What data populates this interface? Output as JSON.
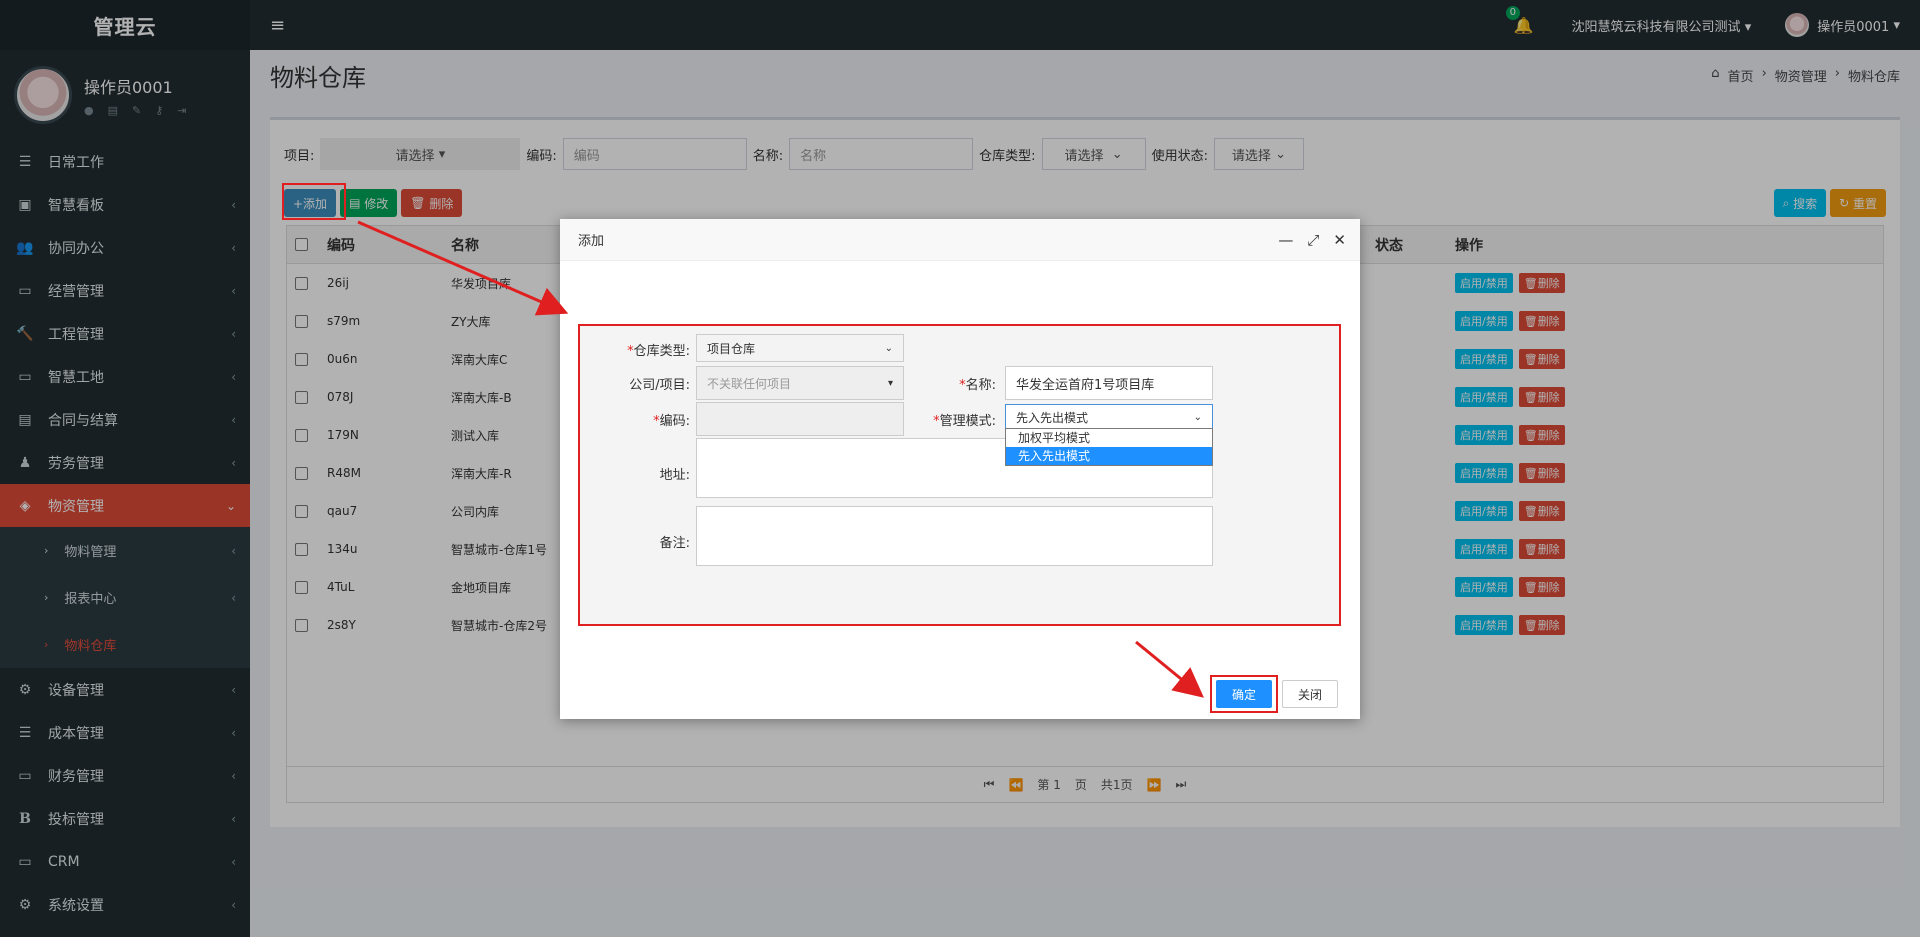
{
  "app": {
    "brand": "管理云",
    "user_name": "操作员0001"
  },
  "header": {
    "notif_count": "0",
    "company": "沈阳慧筑云科技有限公司测试",
    "user": "操作员0001"
  },
  "sidebar": {
    "items": [
      {
        "label": "日常工作",
        "icon": "☰"
      },
      {
        "label": "智慧看板",
        "icon": "▣"
      },
      {
        "label": "协同办公",
        "icon": "👥"
      },
      {
        "label": "经营管理",
        "icon": "▭"
      },
      {
        "label": "工程管理",
        "icon": "🔨"
      },
      {
        "label": "智慧工地",
        "icon": "▭"
      },
      {
        "label": "合同与结算",
        "icon": "▤"
      },
      {
        "label": "劳务管理",
        "icon": "♟"
      },
      {
        "label": "物资管理",
        "icon": "◈"
      }
    ],
    "sub_items": [
      {
        "label": "物料管理"
      },
      {
        "label": "报表中心"
      },
      {
        "label": "物料仓库"
      }
    ],
    "items_after": [
      {
        "label": "设备管理",
        "icon": "⚙"
      },
      {
        "label": "成本管理",
        "icon": "☰"
      },
      {
        "label": "财务管理",
        "icon": "▭"
      },
      {
        "label": "投标管理",
        "icon": "B"
      },
      {
        "label": "CRM",
        "icon": "▭"
      },
      {
        "label": "系统设置",
        "icon": "⚙"
      }
    ]
  },
  "page": {
    "title": "物料仓库",
    "breadcrumb": [
      "首页",
      "物资管理",
      "物料仓库"
    ]
  },
  "filters": {
    "project_label": "项目:",
    "project_value": "请选择",
    "code_label": "编码:",
    "code_placeholder": "编码",
    "name_label": "名称:",
    "name_placeholder": "名称",
    "type_label": "仓库类型:",
    "type_value": "请选择",
    "status_label": "使用状态:",
    "status_value": "请选择"
  },
  "toolbar": {
    "add": "+添加",
    "edit": "修改",
    "delete": "删除",
    "search": "搜索",
    "reset": "重置"
  },
  "table": {
    "headers": {
      "code": "编码",
      "name": "名称",
      "state": "状态",
      "ops": "操作"
    },
    "op_toggle": "启用/禁用",
    "op_delete": "删除",
    "rows": [
      {
        "code": "26ij",
        "name": "华发项目库"
      },
      {
        "code": "s79m",
        "name": "ZY大库"
      },
      {
        "code": "0u6n",
        "name": "浑南大库C"
      },
      {
        "code": "078J",
        "name": "浑南大库-B"
      },
      {
        "code": "179N",
        "name": "测试入库"
      },
      {
        "code": "R48M",
        "name": "浑南大库-R"
      },
      {
        "code": "qau7",
        "name": "公司内库"
      },
      {
        "code": "134u",
        "name": "智慧城市-仓库1号"
      },
      {
        "code": "4TuL",
        "name": "金地项目库"
      },
      {
        "code": "2s8Y",
        "name": "智慧城市-仓库2号"
      }
    ],
    "pager": {
      "page_prefix": "第",
      "page_num": "1",
      "page_suffix": "页",
      "total": "共1页"
    }
  },
  "dialog": {
    "title": "添加",
    "warehouse_type_label": "仓库类型:",
    "warehouse_type_value": "项目仓库",
    "company_label": "公司/项目:",
    "company_value": "不关联任何项目",
    "name_label": "名称:",
    "name_value": "华发全运首府1号项目库",
    "code_label": "编码:",
    "mode_label": "管理模式:",
    "mode_value": "先入先出模式",
    "mode_options": [
      "加权平均模式",
      "先入先出模式"
    ],
    "address_label": "地址:",
    "remark_label": "备注:",
    "confirm": "确定",
    "close": "关闭"
  },
  "colors": {
    "accent": "#dd4b39",
    "primary": "#1e90ff",
    "highlight": "#e02020"
  }
}
